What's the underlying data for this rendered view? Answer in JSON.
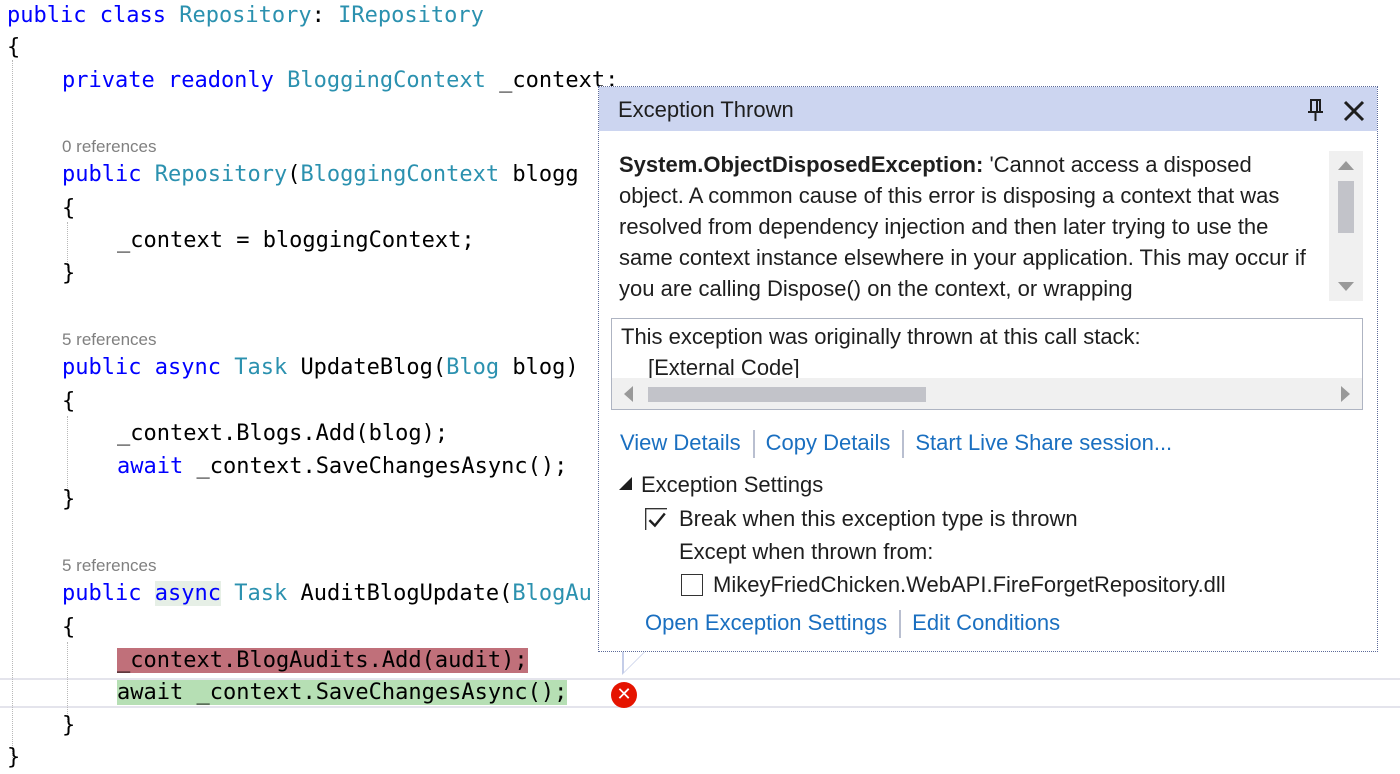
{
  "editor": {
    "lines": {
      "l1_kw": "public class",
      "l1_type": "Repository",
      "l1_colon": ":",
      "l1_iface": "IRepository",
      "l2": "{",
      "l3_kw": "private readonly",
      "l3_type": "BloggingContext",
      "l3_rest": "_context;",
      "lens1": "0 references",
      "l5_kw": "public",
      "l5_type": "Repository",
      "l5_paren": "(",
      "l5_type2": "BloggingContext",
      "l5_rest": "blogg",
      "l6": "{",
      "l7": "_context = bloggingContext;",
      "l8": "}",
      "lens2": "5 references",
      "l10_kw": "public async",
      "l10_type": "Task",
      "l10_name": "UpdateBlog(",
      "l10_type2": "Blog",
      "l10_rest": "blog)",
      "l11": "{",
      "l12": "_context.Blogs.Add(blog);",
      "l13_kw": "await",
      "l13_rest": "_context.SaveChangesAsync();",
      "l14": "}",
      "lens3": "5 references",
      "l16_kw1": "public",
      "l16_kw2": "async",
      "l16_type": "Task",
      "l16_name": "AuditBlogUpdate(",
      "l16_type2": "BlogAu",
      "l17": "{",
      "l18": "_context.BlogAudits.Add(audit);",
      "l19_kw": "await",
      "l19_rest": "_context.SaveChangesAsync();",
      "l20": "}",
      "l21": "}"
    },
    "error_glyph": "✕"
  },
  "popup": {
    "title": "Exception Thrown",
    "exception_type": "System.ObjectDisposedException:",
    "message": " 'Cannot access a disposed object. A common cause of this error is disposing a context that was resolved from dependency injection and then later trying to use the same context instance elsewhere in your application. This may occur if you are calling Dispose() on the context, or wrapping",
    "stack_header": "This exception was originally thrown at this call stack:",
    "stack_frame": "[External Code]",
    "links": {
      "view_details": "View Details",
      "copy_details": "Copy Details",
      "live_share": "Start Live Share session..."
    },
    "settings": {
      "heading": "Exception Settings",
      "break_label": "Break when this exception type is thrown",
      "break_checked": true,
      "except_label": "Except when thrown from:",
      "module_label": "MikeyFriedChicken.WebAPI.FireForgetRepository.dll",
      "module_checked": false,
      "open_settings": "Open Exception Settings",
      "edit_conditions": "Edit Conditions"
    }
  },
  "colors": {
    "keyword": "#0000ff",
    "type": "#2b91af",
    "link": "#1a6fc0",
    "header_bg": "#ccd5f0",
    "highlight_red": "#c0707a",
    "highlight_green": "#b6dfb4",
    "error": "#e51400"
  }
}
